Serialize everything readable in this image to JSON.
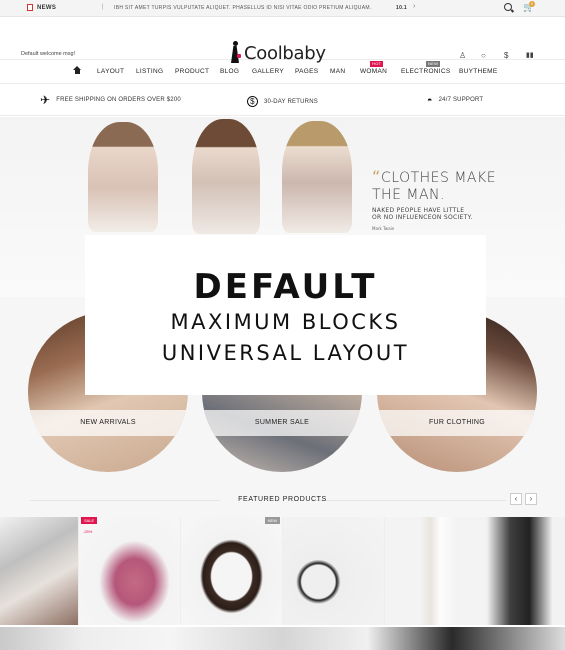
{
  "topbar": {
    "news_label": "NEWS",
    "ticker": "IBH SIT AMET TURPIS VULPUTATE ALIQUET. PHASELLUS ID NISI VITAE ODIO PRETIUM ALIQUAM.",
    "ticker_count": "10.1",
    "cart_count": "0"
  },
  "header": {
    "welcome": "Default welcome msg!",
    "logo_text": "Coolbaby"
  },
  "nav": {
    "items": [
      "LAYOUT",
      "LISTING",
      "PRODUCT",
      "BLOG",
      "GALLERY",
      "PAGES",
      "MAN",
      "WOMAN",
      "ELECTRONICS",
      "BUYTHEME"
    ],
    "woman_tag": "HOT",
    "electronics_tag": "NEW"
  },
  "services": {
    "shipping": "FREE SHIPPING ON ORDERS OVER $200",
    "returns": "30-DAY RETURNS",
    "support": "24/7 SUPPORT"
  },
  "hero": {
    "quote_line1": "CLOTHES MAKE",
    "quote_line2": "THE MAN.",
    "quote_sub1": "NAKED PEOPLE HAVE LITTLE",
    "quote_sub2": "OR NO INFLUENCEON SOCIETY.",
    "quote_author": "Mark Twain"
  },
  "overlay": {
    "title": "DEFAULT",
    "line2": "MAXIMUM BLOCKS",
    "line3": "UNIVERSAL LAYOUT"
  },
  "categories": [
    "NEW ARRIVALS",
    "SUMMER SALE",
    "FUR CLOTHING"
  ],
  "featured": {
    "title": "FEATURED PRODUCTS",
    "sale_tag": "SALE",
    "sale_discount": "-25%",
    "new_tag": "NEW"
  },
  "colors": {
    "accent_red": "#e0174f",
    "gold": "#c9a366",
    "cart_badge": "#e2a23a"
  }
}
